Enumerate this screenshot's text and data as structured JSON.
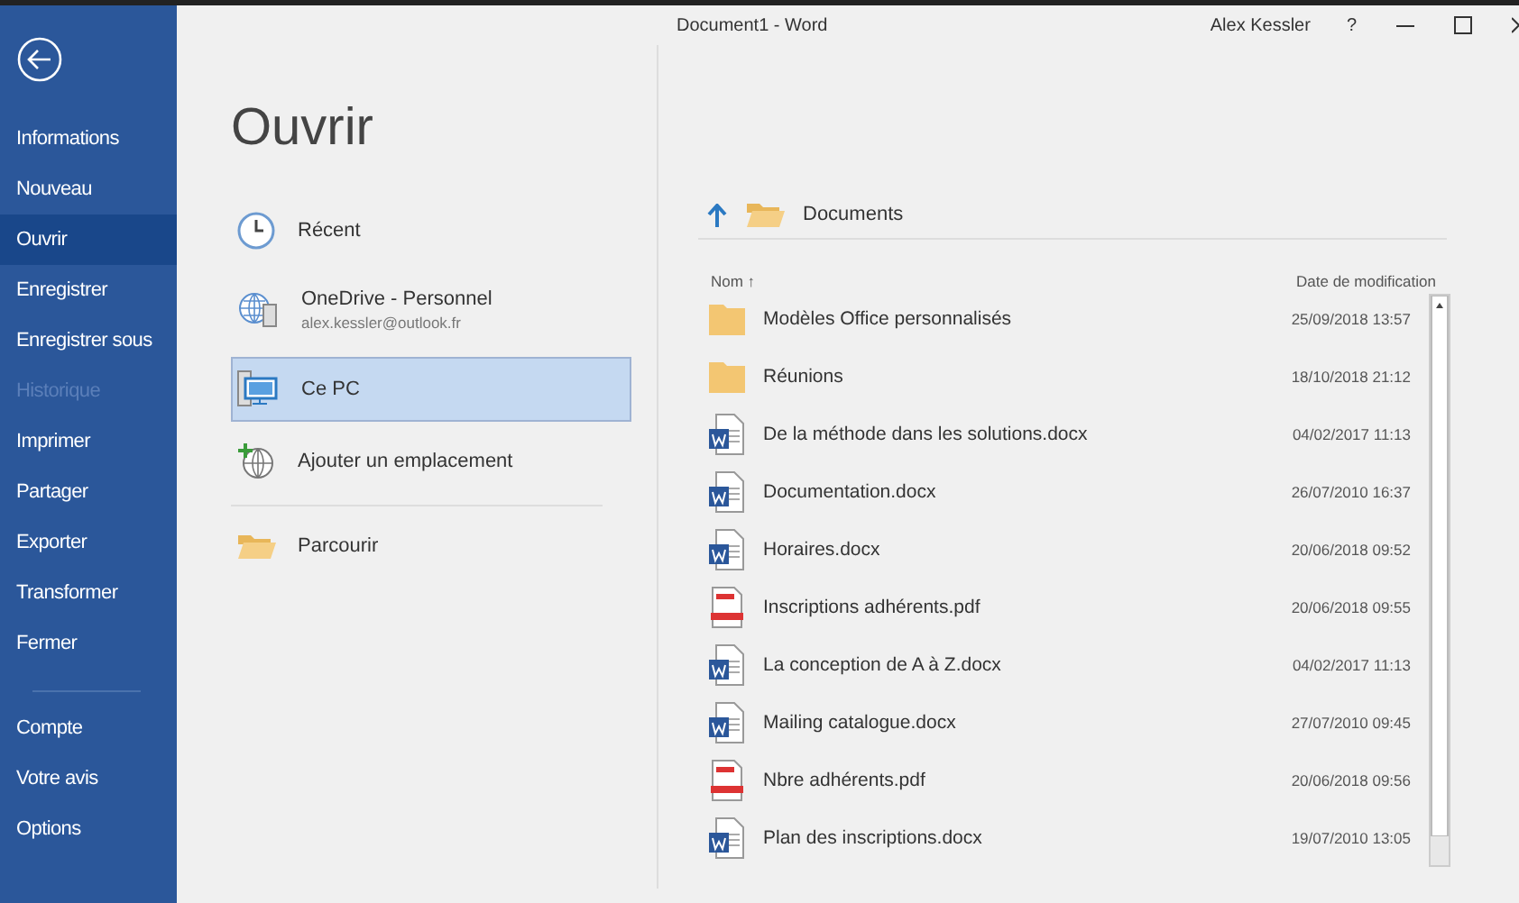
{
  "window": {
    "title": "Document1  -  Word",
    "user": "Alex Kessler",
    "help": "?"
  },
  "sidebar": {
    "items": [
      {
        "label": "Informations",
        "selected": false,
        "disabled": false
      },
      {
        "label": "Nouveau",
        "selected": false,
        "disabled": false
      },
      {
        "label": "Ouvrir",
        "selected": true,
        "disabled": false
      },
      {
        "label": "Enregistrer",
        "selected": false,
        "disabled": false
      },
      {
        "label": "Enregistrer sous",
        "selected": false,
        "disabled": false
      },
      {
        "label": "Historique",
        "selected": false,
        "disabled": true
      },
      {
        "label": "Imprimer",
        "selected": false,
        "disabled": false
      },
      {
        "label": "Partager",
        "selected": false,
        "disabled": false
      },
      {
        "label": "Exporter",
        "selected": false,
        "disabled": false
      },
      {
        "label": "Transformer",
        "selected": false,
        "disabled": false
      },
      {
        "label": "Fermer",
        "selected": false,
        "disabled": false
      }
    ],
    "footer_items": [
      {
        "label": "Compte",
        "selected": false,
        "disabled": false
      },
      {
        "label": "Votre avis",
        "selected": false,
        "disabled": false
      },
      {
        "label": "Options",
        "selected": false,
        "disabled": false
      }
    ]
  },
  "page_title": "Ouvrir",
  "places": [
    {
      "kind": "recent",
      "label": "Récent",
      "selected": false
    },
    {
      "kind": "onedrive",
      "label": "OneDrive - Personnel",
      "sublabel": "alex.kessler@outlook.fr",
      "selected": false
    },
    {
      "kind": "pc",
      "label": "Ce PC",
      "selected": true
    },
    {
      "kind": "add",
      "label": "Ajouter un emplacement",
      "selected": false
    },
    {
      "kind": "browse",
      "label": "Parcourir",
      "selected": false
    }
  ],
  "browser": {
    "folder": "Documents",
    "columns": [
      "Nom ↑",
      "Date de modification"
    ],
    "files": [
      {
        "kind": "folder",
        "name": "Modèles Office personnalisés",
        "date": "25/09/2018 13:57"
      },
      {
        "kind": "folder",
        "name": "Réunions",
        "date": "18/10/2018 21:12"
      },
      {
        "kind": "word",
        "name": "De la méthode dans les solutions.docx",
        "date": "04/02/2017 11:13"
      },
      {
        "kind": "word",
        "name": "Documentation.docx",
        "date": "26/07/2010 16:37"
      },
      {
        "kind": "word",
        "name": "Horaires.docx",
        "date": "20/06/2018 09:52"
      },
      {
        "kind": "pdf",
        "name": "Inscriptions adhérents.pdf",
        "date": "20/06/2018 09:55"
      },
      {
        "kind": "word",
        "name": "La conception de A à Z.docx",
        "date": "04/02/2017 11:13"
      },
      {
        "kind": "word",
        "name": "Mailing catalogue.docx",
        "date": "27/07/2010 09:45"
      },
      {
        "kind": "pdf",
        "name": "Nbre adhérents.pdf",
        "date": "20/06/2018 09:56"
      },
      {
        "kind": "word",
        "name": "Plan des inscriptions.docx",
        "date": "19/07/2010 13:05"
      }
    ]
  }
}
